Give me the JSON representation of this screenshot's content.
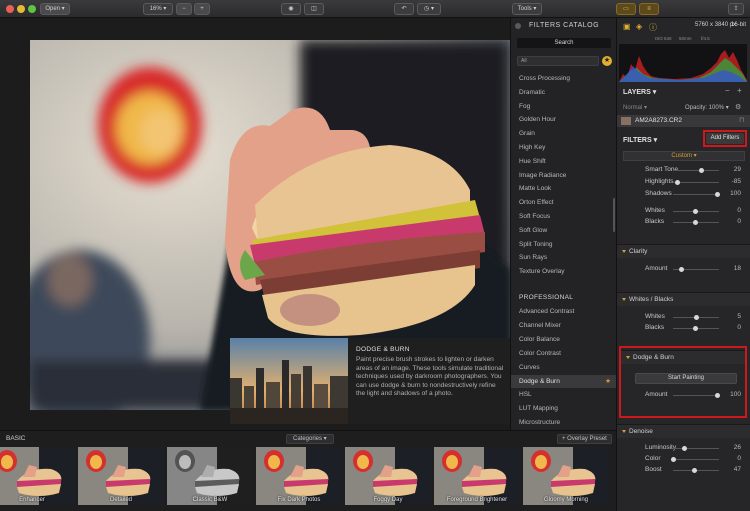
{
  "toolbar": {
    "open_label": "Open",
    "zoom_label": "16%",
    "zoom_out": "−",
    "zoom_in": "+",
    "tools_label": "Tools"
  },
  "catalog": {
    "title": "FILTERS CATALOG",
    "search_label": "Search",
    "filter_select": "All",
    "items_top": [
      "Cross Processing",
      "Dramatic",
      "Fog",
      "Golden Hour",
      "Grain",
      "High Key",
      "Hue Shift",
      "Image Radiance",
      "Matte Look",
      "Orton Effect",
      "Soft Focus",
      "Soft Glow",
      "Split Toning",
      "Sun Rays",
      "Texture Overlay"
    ],
    "section_professional": "PROFESSIONAL",
    "items_pro": [
      "Advanced Contrast",
      "Channel Mixer",
      "Color Balance",
      "Color Contrast",
      "Curves",
      "Dodge & Burn",
      "HSL",
      "LUT Mapping",
      "Microstructure"
    ],
    "selected_item": "Dodge & Burn"
  },
  "tooltip": {
    "title": "DODGE & BURN",
    "description": "Paint precise brush strokes to lighten or darken areas of an image. These tools simulate traditional techniques used by darkroom photographers. You can use dodge & burn to nondestructively refine the light and shadows of a photo."
  },
  "right_panel": {
    "image_size": "5760 x 3840 px",
    "bit_depth": "16-bit",
    "iso": "ISO 640",
    "focal": "50mm",
    "aperture": "f/4.5",
    "layers_title": "LAYERS",
    "blend_mode": "Normal",
    "opacity": "Opacity: 100%",
    "layer_name": "AM2A8273.CR2",
    "filters_title": "FILTERS",
    "add_filters": "Add Filters",
    "preset_select": "Custom",
    "accent": "#d0a030",
    "highlight_red": "#d0171b"
  },
  "sliders_top": [
    {
      "label": "Smart Tone",
      "value": "29",
      "pos": 0.64
    },
    {
      "label": "Highlights",
      "value": "-85",
      "pos": 0.08
    },
    {
      "label": "Shadows",
      "value": "100",
      "pos": 1.0
    },
    {
      "label": "Whites",
      "value": "0",
      "pos": 0.5
    },
    {
      "label": "Blacks",
      "value": "0",
      "pos": 0.5
    }
  ],
  "clarity": {
    "title": "Clarity",
    "sliders": [
      {
        "label": "Amount",
        "value": "18",
        "pos": 0.18
      }
    ]
  },
  "whites_blacks": {
    "title": "Whites / Blacks",
    "sliders": [
      {
        "label": "Whites",
        "value": "5",
        "pos": 0.52
      },
      {
        "label": "Blacks",
        "value": "0",
        "pos": 0.5
      }
    ]
  },
  "dodge_burn": {
    "title": "Dodge & Burn",
    "start_label": "Start Painting",
    "sliders": [
      {
        "label": "Amount",
        "value": "100",
        "pos": 1.0
      }
    ]
  },
  "denoise": {
    "title": "Denoise",
    "sliders": [
      {
        "label": "Luminosity",
        "value": "26",
        "pos": 0.26
      },
      {
        "label": "Color",
        "value": "0",
        "pos": 0.0
      },
      {
        "label": "Boost",
        "value": "47",
        "pos": 0.47
      }
    ]
  },
  "bottom": {
    "basic_label": "BASIC",
    "categories_label": "Categories",
    "overlay_label": "+ Overlay Preset",
    "presets": [
      "Enhancer",
      "Detailed",
      "Classic B&W",
      "Fix Dark Photos",
      "Foggy Day",
      "Foreground Brightener",
      "Gloomy Morning"
    ]
  }
}
